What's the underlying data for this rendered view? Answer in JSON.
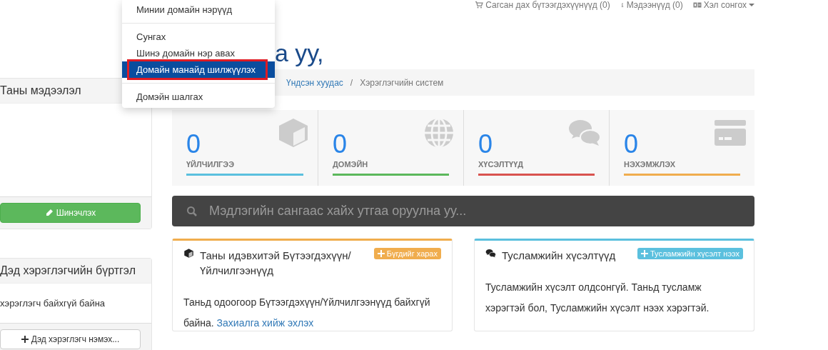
{
  "top_nav": [
    {
      "kind": "cart",
      "label": "Сагсан дах бүтээгдэхүүнүүд (0)"
    },
    {
      "kind": "info",
      "label": "Мэдээнүүд (0)"
    },
    {
      "kind": "language",
      "label": "Хэл сонгох"
    }
  ],
  "dropdown": {
    "items": [
      {
        "label": "Минии домайн нэрүүд",
        "selected": false
      },
      {
        "label": "Сунгах",
        "selected": false
      },
      {
        "label": "Шинэ домайн нэр авах",
        "selected": false
      },
      {
        "label": "Домайн манайд шилжүүлэх",
        "selected": true
      },
      {
        "label": "Домэйн шалгах",
        "selected": false
      }
    ]
  },
  "sidebar": {
    "panels": [
      {
        "title": "Таны мэдээлэл",
        "button": {
          "label": "Шинэчлэх",
          "kind": "success"
        }
      },
      {
        "title": "Дэд хэрэглэгчийн бүртгэл",
        "body": "хэрэглэгч байхгүй байна",
        "button": {
          "label": "Дэд хэрэглэгч нэмэх...",
          "kind": "default"
        }
      }
    ]
  },
  "heading": "а уу,",
  "breadcrumb": {
    "items": [
      "Үндсэн хуудас",
      "Хэрэглэгчийн систем"
    ],
    "separator": "/"
  },
  "stats": [
    {
      "kind": "box",
      "value": "0",
      "label": "ҮЙЛЧИЛГЭЭ",
      "color": "#5bc0de"
    },
    {
      "kind": "globe",
      "value": "0",
      "label": "ДОМЭЙН",
      "color": "#5cb85c"
    },
    {
      "kind": "chat",
      "value": "0",
      "label": "ХҮСЭЛТҮҮД",
      "color": "#d9534f"
    },
    {
      "kind": "card",
      "value": "0",
      "label": "НЭХЭМЖЛЭХ",
      "color": "#f0ad4e"
    }
  ],
  "search": {
    "placeholder": "Мэдлэгийн сангаас хайх утгаа оруулна уу..."
  },
  "panels": [
    {
      "kind": "box",
      "color": "#f0ad4e",
      "title": "Таны идэвхитэй Бүтээгдэхүүн/Үйлчилгээнүүд",
      "button": "Бүгдийг харах",
      "body": "Таньд одоогоор Бүтээгдэхүүн/Үйлчилгээнүүд байхгүй байна.",
      "link": "Захиалга хийж эхлэх"
    },
    {
      "kind": "chat",
      "color": "#5bc0de",
      "title": "Тусламжийн хүсэлтүүд",
      "button": "Тусламжийн хүсэлт нээх",
      "body": "Тусламжийн хүсэлт олдсонгүй. Таньд тусламж хэрэгтэй бол, Тусламжийн хүсэлт нээх хэрэгтэй."
    }
  ]
}
